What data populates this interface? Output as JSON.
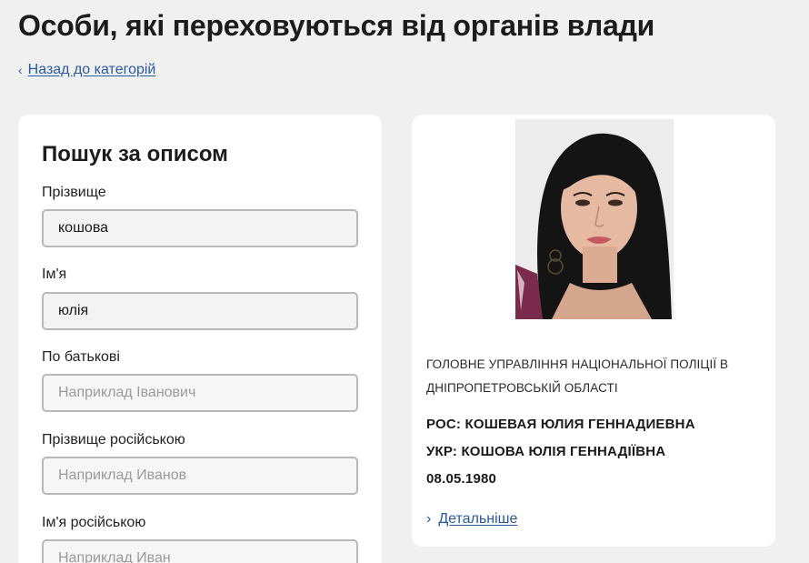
{
  "page": {
    "title": "Особи, які переховуються від органів влади",
    "back_link": "Назад до категорій"
  },
  "search": {
    "heading": "Пошук за описом",
    "fields": [
      {
        "label": "Прізвище",
        "value": "кошова",
        "placeholder": ""
      },
      {
        "label": "Ім'я",
        "value": "юлія",
        "placeholder": ""
      },
      {
        "label": "По батькові",
        "value": "",
        "placeholder": "Наприклад Іванович"
      },
      {
        "label": "Прізвище російською",
        "value": "",
        "placeholder": "Наприклад Иванов"
      },
      {
        "label": "Ім'я російською",
        "value": "",
        "placeholder": "Наприклад Иван"
      }
    ]
  },
  "result": {
    "agency": "Головне управління національної поліції в Дніпропетровській області",
    "ros": "РОС: КОШЕВАЯ ЮЛИЯ ГЕННАДИЕВНА",
    "ukr": "УКР: КОШОВА ЮЛІЯ ГЕННАДІЇВНА",
    "dob": "08.05.1980",
    "details_link": "Детальніше"
  },
  "icons": {
    "back": "chevron-left-icon",
    "details": "chevron-right-icon"
  },
  "colors": {
    "link": "#2a5a9e",
    "background": "#f0f0f0",
    "card": "#ffffff",
    "input_border": "#b8b8b8"
  }
}
